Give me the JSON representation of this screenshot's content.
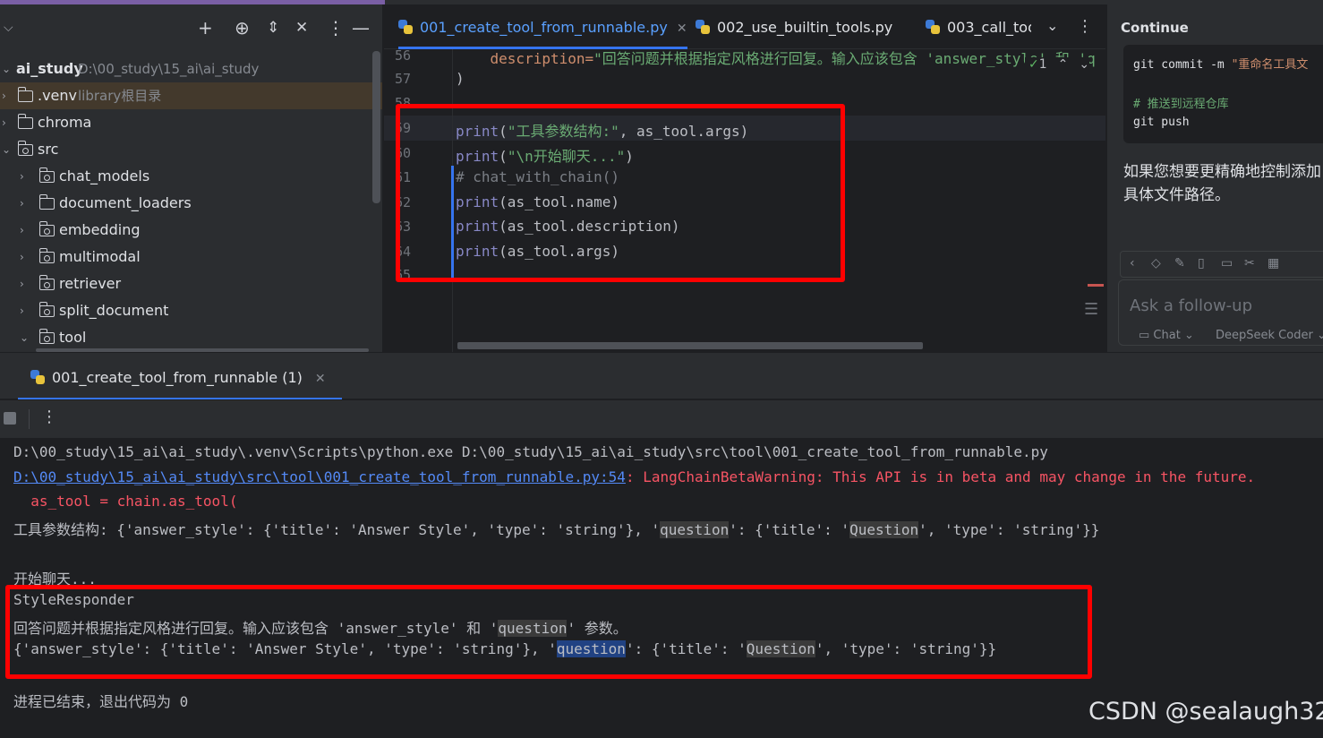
{
  "project": {
    "root_name": "ai_study",
    "root_path": "D:\\00_study\\15_ai\\ai_study",
    "items": [
      {
        "label": "ai_study",
        "path": "D:\\00_study\\15_ai\\ai_study"
      },
      {
        "label": ".venv",
        "hint": "library根目录"
      },
      {
        "label": "chroma"
      },
      {
        "label": "src"
      },
      {
        "label": "chat_models"
      },
      {
        "label": "document_loaders"
      },
      {
        "label": "embedding"
      },
      {
        "label": "multimodal"
      },
      {
        "label": "retriever"
      },
      {
        "label": "split_document"
      },
      {
        "label": "tool"
      }
    ],
    "toolbar_icons": [
      "add-icon",
      "target-icon",
      "expand-icon",
      "collapse-icon",
      "more-icon",
      "minimize-icon"
    ]
  },
  "editor": {
    "tabs": [
      {
        "label": "001_create_tool_from_runnable.py",
        "active": true
      },
      {
        "label": "002_use_builtin_tools.py",
        "active": false
      },
      {
        "label": "003_call_too",
        "active": false
      }
    ],
    "inspection_count": "1",
    "line_numbers": [
      "56",
      "57",
      "58",
      "59",
      "60",
      "61",
      "62",
      "63",
      "64",
      "65"
    ],
    "lines": {
      "l56_indent": "    description=",
      "l56_str": "\"回答问题并根据指定风格进行回复。输入应该包含 'answer_style' 和 'q",
      "l57": ")",
      "l59_fn": "print",
      "l59_str": "\"工具参数结构:\"",
      "l59_rest": ", as_tool.args)",
      "l60_fn": "print",
      "l60_str": "\"\\n开始聊天...\"",
      "l61": "# chat_with_chain()",
      "l62_fn": "print",
      "l62_rest": "(as_tool.name)",
      "l63_fn": "print",
      "l63_rest": "(as_tool.description)",
      "l64_fn": "print",
      "l64_rest": "(as_tool.args)"
    }
  },
  "chat": {
    "title": "Continue",
    "code": {
      "line1_cmd": "git commit -m ",
      "line1_str": "\"重命名工具文",
      "comment": "# 推送到远程仓库",
      "line3": "git push"
    },
    "text_line1": "如果您想要更精确地控制添加",
    "text_line2": "具体文件路径。",
    "input_placeholder": "Ask a follow-up",
    "mode": "Chat",
    "model": "DeepSeek Coder"
  },
  "run": {
    "tab_label": "001_create_tool_from_runnable (1)",
    "output": {
      "cmd": "D:\\00_study\\15_ai\\ai_study\\.venv\\Scripts\\python.exe D:\\00_study\\15_ai\\ai_study\\src\\tool\\001_create_tool_from_runnable.py",
      "warn_link": "D:\\00_study\\15_ai\\ai_study\\src\\tool\\001_create_tool_from_runnable.py:54",
      "warn_text": ": LangChainBetaWarning: This API is in beta and may change in the future.",
      "warn_code": "  as_tool = chain.as_tool(",
      "params_prefix": "工具参数结构: {'answer_style': {'title': 'Answer Style', 'type': 'string'}, '",
      "params_q1": "question",
      "params_mid": "': {'title': '",
      "params_q2": "Question",
      "params_end": "', 'type': 'string'}}",
      "blank": "",
      "start_chat": "开始聊天...",
      "name": "StyleResponder",
      "desc_prefix": "回答问题并根据指定风格进行回复。输入应该包含 'answer_style' 和 '",
      "desc_q": "question",
      "desc_end": "' 参数。",
      "args_prefix": "{'answer_style': {'title': 'Answer Style', 'type': 'string'}, '",
      "args_q1": "question",
      "args_mid": "': {'title': '",
      "args_q2": "Question",
      "args_end": "', 'type': 'string'}}",
      "exit": "进程已结束，退出代码为 0"
    }
  },
  "watermark": "CSDN @sealaugh32",
  "colors": {
    "accent": "#3574f0",
    "annotation_red": "#ff0000",
    "string_green": "#6aab73",
    "error_red": "#f75464"
  }
}
